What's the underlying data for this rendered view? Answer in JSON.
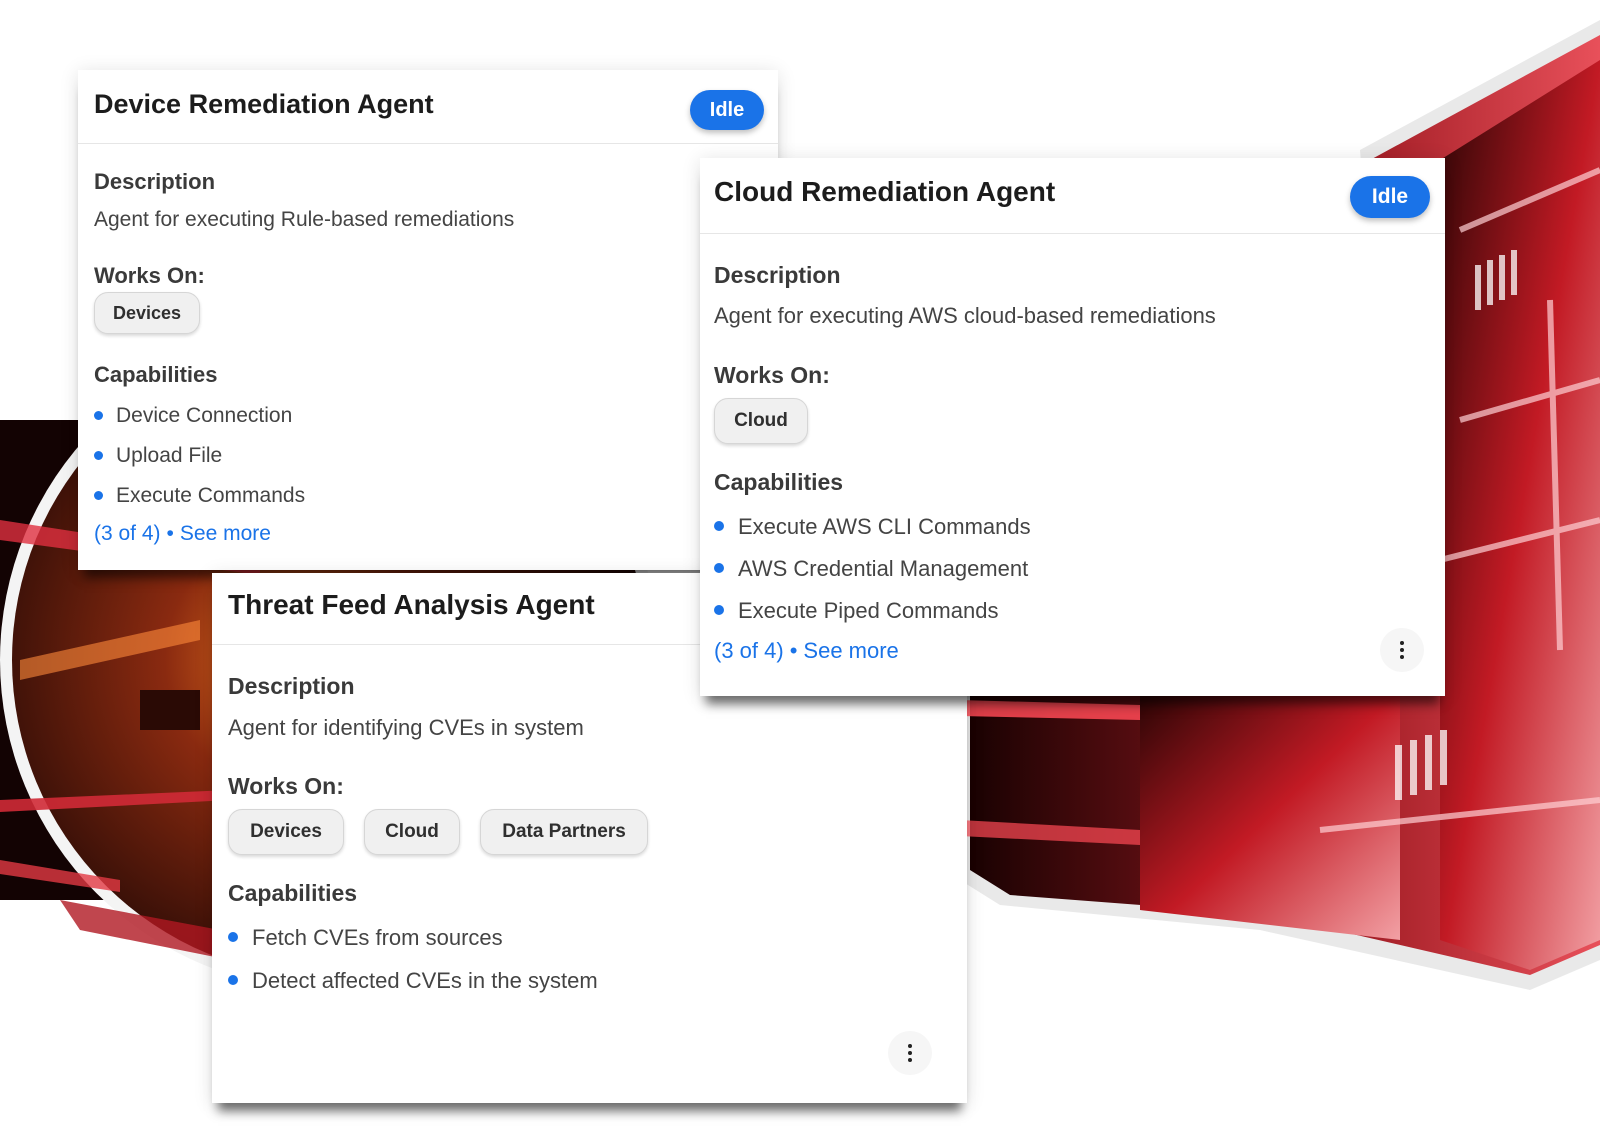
{
  "colors": {
    "accent": "#1a73e8",
    "status_idle": "#1a73e8"
  },
  "cards": [
    {
      "title": "Device Remediation Agent",
      "status": "Idle",
      "description_label": "Description",
      "description": "Agent for executing Rule-based remediations",
      "works_on_label": "Works On:",
      "works_on": [
        "Devices"
      ],
      "capabilities_label": "Capabilities",
      "capabilities": [
        "Device Connection",
        "Upload File",
        "Execute Commands"
      ],
      "capabilities_count": "(3 of 4)",
      "separator": "•",
      "see_more": "See more"
    },
    {
      "title": "Cloud Remediation Agent",
      "status": "Idle",
      "description_label": "Description",
      "description": "Agent for executing AWS cloud-based remediations",
      "works_on_label": "Works On:",
      "works_on": [
        "Cloud"
      ],
      "capabilities_label": "Capabilities",
      "capabilities": [
        "Execute AWS CLI Commands",
        "AWS Credential Management",
        "Execute Piped Commands"
      ],
      "capabilities_count": "(3 of 4)",
      "separator": "•",
      "see_more": "See more",
      "menu_icon": "more-vertical-icon"
    },
    {
      "title": "Threat Feed Analysis Agent",
      "description_label": "Description",
      "description": "Agent for identifying CVEs in system",
      "works_on_label": "Works On:",
      "works_on": [
        "Devices",
        "Cloud",
        "Data Partners"
      ],
      "capabilities_label": "Capabilities",
      "capabilities": [
        "Fetch CVEs from sources",
        "Detect affected CVEs in the system"
      ],
      "menu_icon": "more-vertical-icon"
    }
  ]
}
